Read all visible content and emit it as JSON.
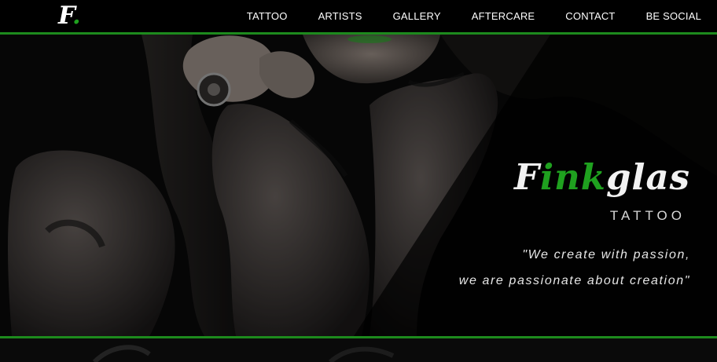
{
  "logo": {
    "letter": "F",
    "dot": "."
  },
  "nav": {
    "items": [
      {
        "label": "TATTOO"
      },
      {
        "label": "ARTISTS"
      },
      {
        "label": "GALLERY"
      },
      {
        "label": "AFTERCARE"
      },
      {
        "label": "CONTACT"
      },
      {
        "label": "BE SOCIAL"
      }
    ]
  },
  "hero": {
    "brand_part1": "F",
    "brand_green": "ink",
    "brand_part2": "glas",
    "subtitle": "TATTOO",
    "quote_line1": "\"We create with passion,",
    "quote_line2": "we are passionate about creation\""
  },
  "colors": {
    "accent": "#1d8a1d",
    "background": "#000000",
    "text": "#ffffff"
  }
}
